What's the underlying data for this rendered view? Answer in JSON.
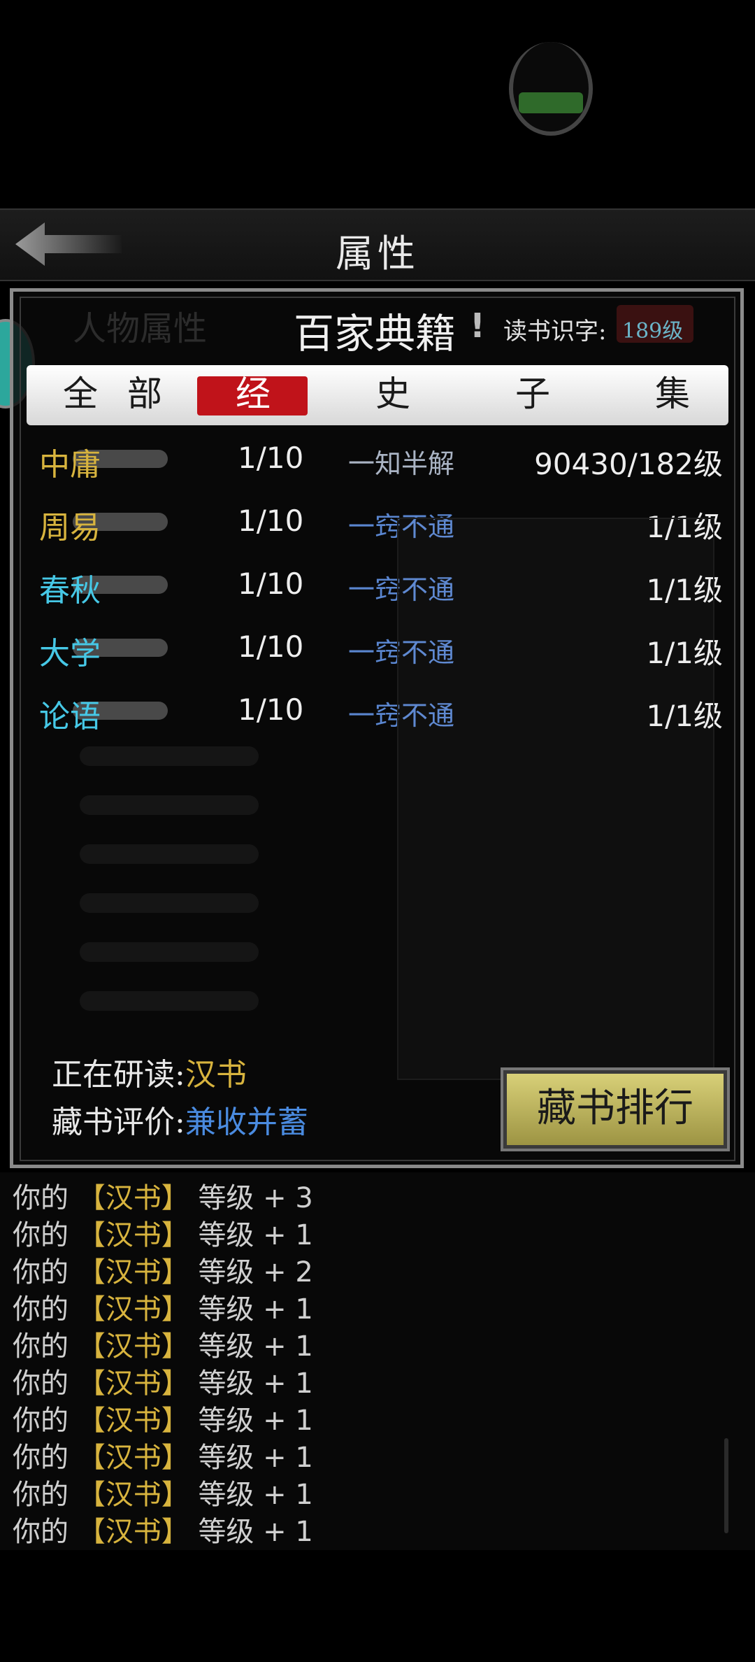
{
  "header": {
    "title": "属性"
  },
  "panel": {
    "char_attr_tab": "人物属性",
    "title": "百家典籍",
    "exclaim": "!",
    "reading_label": "读书识字:",
    "reading_level": "189级"
  },
  "tabs": [
    {
      "label": "全",
      "active": false
    },
    {
      "label": "部",
      "active": false
    },
    {
      "label": "经",
      "active": true
    },
    {
      "label": "史",
      "active": false
    },
    {
      "label": "子",
      "active": false
    },
    {
      "label": "集",
      "active": false
    }
  ],
  "books": [
    {
      "name": "中庸",
      "name_color": "#d8b43e",
      "progress": "1/10",
      "status": "一知半解",
      "status_color": "#aab4c4",
      "level": "90430/182级"
    },
    {
      "name": "周易",
      "name_color": "#d8b43e",
      "progress": "1/10",
      "status": "一窍不通",
      "status_color": "#5a86d0",
      "level": "1/1级"
    },
    {
      "name": "春秋",
      "name_color": "#46c8e6",
      "progress": "1/10",
      "status": "一窍不通",
      "status_color": "#5a86d0",
      "level": "1/1级"
    },
    {
      "name": "大学",
      "name_color": "#46c8e6",
      "progress": "1/10",
      "status": "一窍不通",
      "status_color": "#5a86d0",
      "level": "1/1级"
    },
    {
      "name": "论语",
      "name_color": "#46c8e6",
      "progress": "1/10",
      "status": "一窍不通",
      "status_color": "#5a86d0",
      "level": "1/1级"
    }
  ],
  "info": {
    "studying_label": "正在研读:",
    "studying_value": "汉书",
    "rating_label": "藏书评价:",
    "rating_value": "兼收并蓄"
  },
  "rank_button": "藏书排行",
  "log": [
    {
      "prefix": "你的",
      "book": "【汉书】",
      "suffix": "等级 + 3"
    },
    {
      "prefix": "你的",
      "book": "【汉书】",
      "suffix": "等级 + 1"
    },
    {
      "prefix": "你的",
      "book": "【汉书】",
      "suffix": "等级 + 2"
    },
    {
      "prefix": "你的",
      "book": "【汉书】",
      "suffix": "等级 + 1"
    },
    {
      "prefix": "你的",
      "book": "【汉书】",
      "suffix": "等级 + 1"
    },
    {
      "prefix": "你的",
      "book": "【汉书】",
      "suffix": "等级 + 1"
    },
    {
      "prefix": "你的",
      "book": "【汉书】",
      "suffix": "等级 + 1"
    },
    {
      "prefix": "你的",
      "book": "【汉书】",
      "suffix": "等级 + 1"
    },
    {
      "prefix": "你的",
      "book": "【汉书】",
      "suffix": "等级 + 1"
    },
    {
      "prefix": "你的",
      "book": "【汉书】",
      "suffix": "等级 + 1"
    }
  ],
  "icons": {
    "back": "back-arrow-icon",
    "info": "exclamation-icon"
  }
}
